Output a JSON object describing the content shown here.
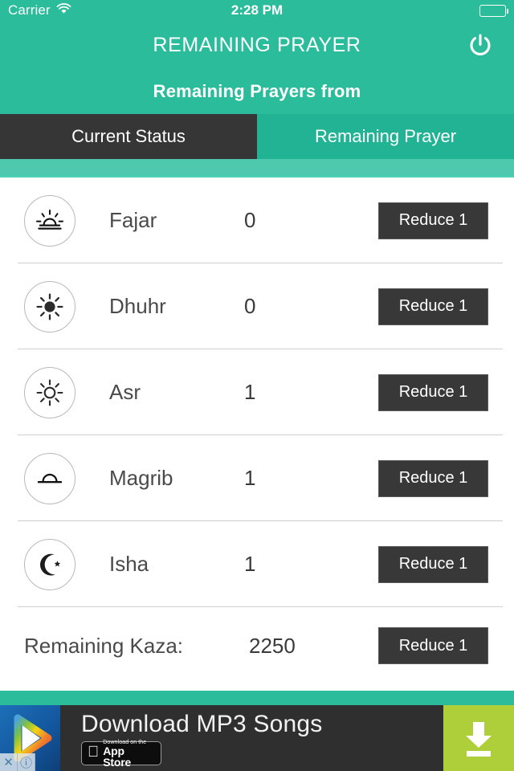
{
  "statusbar": {
    "carrier": "Carrier",
    "wifi_icon": "wifi-icon",
    "time": "2:28 PM",
    "battery_icon": "battery-full-icon"
  },
  "navbar": {
    "title": "REMAINING PRAYER",
    "power_icon": "power-icon"
  },
  "header": {
    "subtitle": "Remaining Prayers from"
  },
  "tabs": [
    {
      "label": "Current Status",
      "active": true
    },
    {
      "label": "Remaining Prayer",
      "active": false
    }
  ],
  "prayers": [
    {
      "icon": "sunrise-icon",
      "name": "Fajar",
      "count": "0",
      "button": "Reduce 1"
    },
    {
      "icon": "sun-filled-icon",
      "name": "Dhuhr",
      "count": "0",
      "button": "Reduce 1"
    },
    {
      "icon": "sun-outline-icon",
      "name": "Asr",
      "count": "1",
      "button": "Reduce 1"
    },
    {
      "icon": "sunset-icon",
      "name": "Magrib",
      "count": "1",
      "button": "Reduce 1"
    },
    {
      "icon": "moon-star-icon",
      "name": "Isha",
      "count": "1",
      "button": "Reduce 1"
    }
  ],
  "kaza": {
    "label": "Remaining Kaza:",
    "count": "2250",
    "button": "Reduce 1"
  },
  "ad": {
    "app_icon": "play-triangle-icon",
    "close_label": "✕",
    "info_label": "ⓘ",
    "title": "Download MP3 Songs",
    "appstore_small": "Download on the",
    "appstore_big": "App Store",
    "cta_icon": "download-icon"
  },
  "colors": {
    "teal": "#2BBC9B",
    "teal_dark": "#21B394",
    "teal_light": "#4EC9AE",
    "dark": "#383838",
    "cta_green": "#AECE3A"
  }
}
